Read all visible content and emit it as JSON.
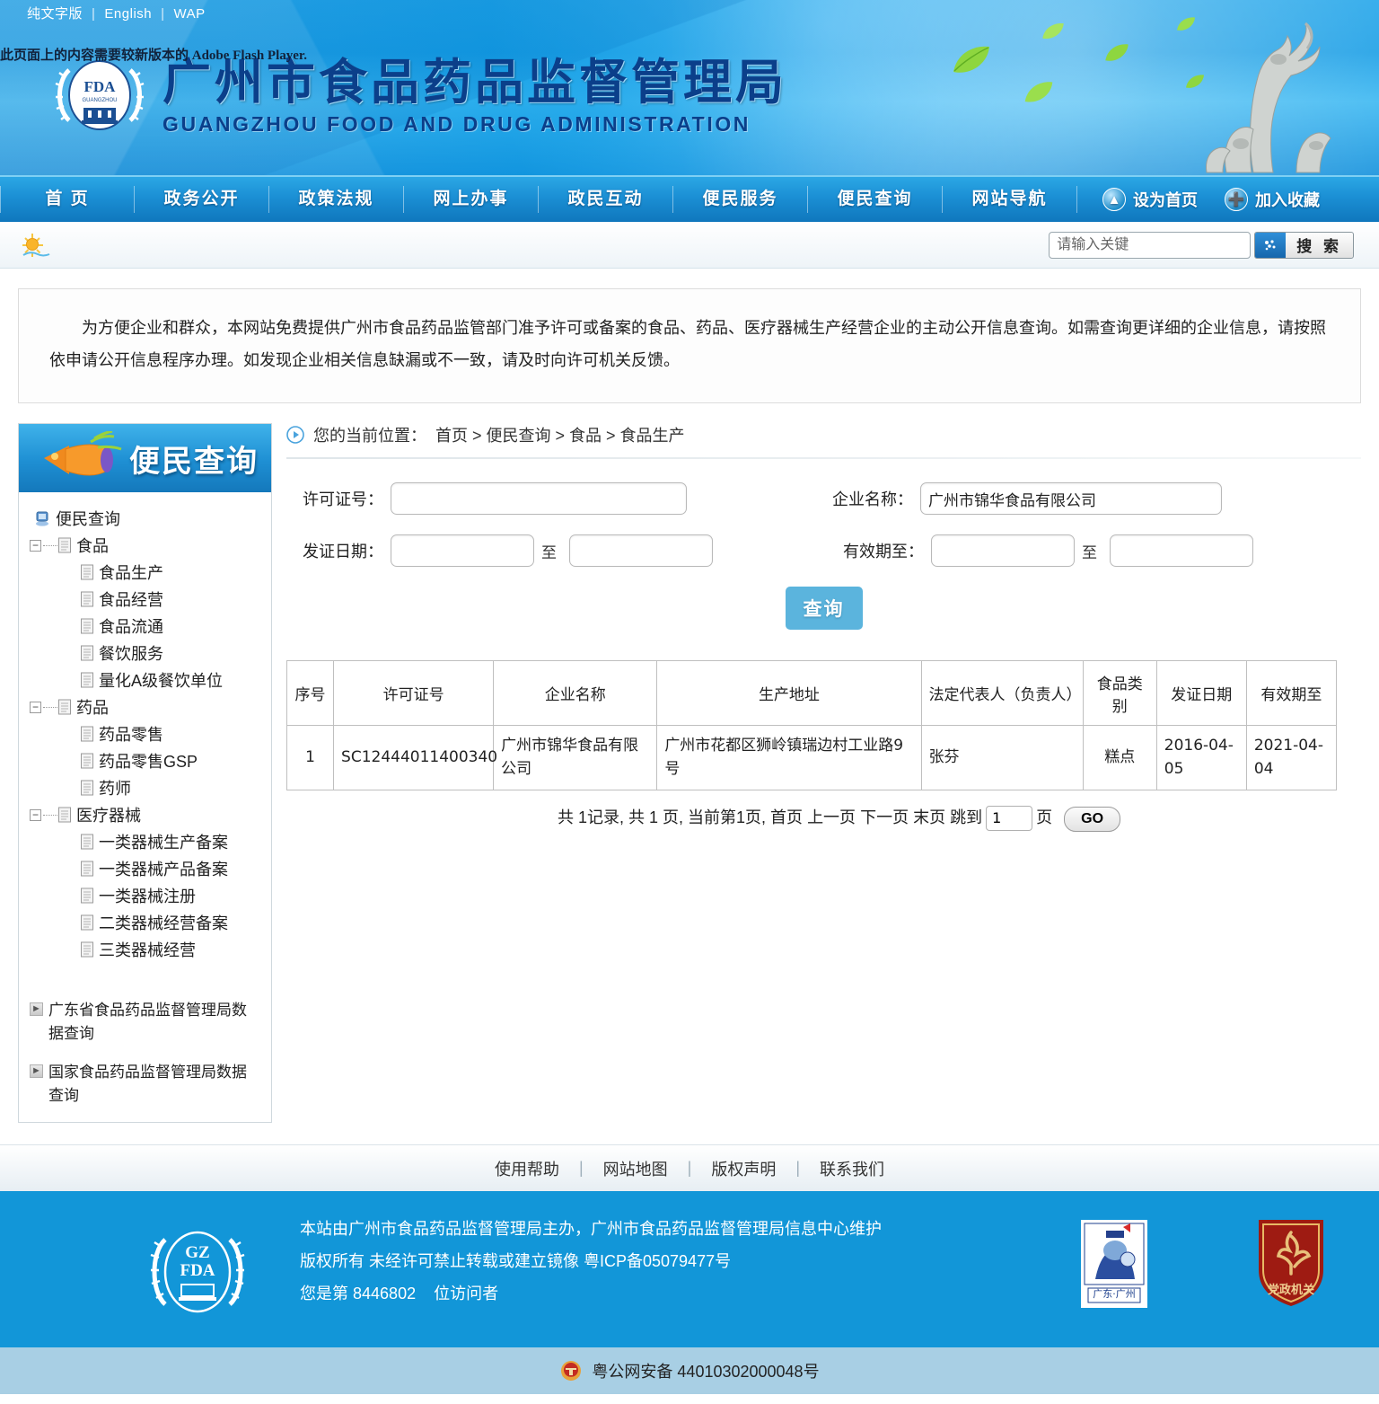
{
  "topbar": {
    "links": [
      "纯文字版",
      "English",
      "WAP"
    ],
    "flash_message": "此页面上的内容需要较新版本的 Adobe Flash Player."
  },
  "header": {
    "zh_title": "广州市食品药品监督管理局",
    "en_title": "GUANGZHOU FOOD AND DRUG ADMINISTRATION",
    "emblem_text": "FDA",
    "emblem_sub": "GZ"
  },
  "nav": {
    "items": [
      "首 页",
      "政务公开",
      "政策法规",
      "网上办事",
      "政民互动",
      "便民服务",
      "便民查询",
      "网站导航"
    ],
    "set_homepage": "设为首页",
    "add_favorite": "加入收藏"
  },
  "search": {
    "placeholder": "请输入关键",
    "button_label": "搜 索"
  },
  "notice": {
    "text": "为方便企业和群众，本网站免费提供广州市食品药品监管部门准予许可或备案的食品、药品、医疗器械生产经营企业的主动公开信息查询。如需查询更详细的企业信息，请按照依申请公开信息程序办理。如发现企业相关信息缺漏或不一致，请及时向许可机关反馈。"
  },
  "sidebar": {
    "panel_title": "便民查询",
    "tree": {
      "root": "便民查询",
      "groups": [
        {
          "label": "食品",
          "children": [
            "食品生产",
            "食品经营",
            "食品流通",
            "餐饮服务",
            "量化A级餐饮单位"
          ]
        },
        {
          "label": "药品",
          "children": [
            "药品零售",
            "药品零售GSP",
            "药师"
          ]
        },
        {
          "label": "医疗器械",
          "children": [
            "一类器械生产备案",
            "一类器械产品备案",
            "一类器械注册",
            "二类器械经营备案",
            "三类器械经营"
          ]
        }
      ]
    },
    "external_links": [
      "广东省食品药品监督管理局数据查询",
      "国家食品药品监督管理局数据查询"
    ]
  },
  "breadcrumb": {
    "prefix": "您的当前位置：",
    "path": "首页 > 便民查询 > 食品 > 食品生产"
  },
  "form": {
    "license_label": "许可证号：",
    "license_value": "",
    "enterprise_label": "企业名称：",
    "enterprise_value": "广州市锦华食品有限公司",
    "issue_date_label": "发证日期：",
    "issue_date_from": "",
    "issue_date_to": "",
    "valid_until_label": "有效期至：",
    "valid_until_from": "",
    "valid_until_to": "",
    "to_label": "至",
    "query_button": "查询"
  },
  "table": {
    "headers": [
      "序号",
      "许可证号",
      "企业名称",
      "生产地址",
      "法定代表人（负责人）",
      "食品类别",
      "发证日期",
      "有效期至"
    ],
    "rows": [
      {
        "no": "1",
        "license": "SC12444011400340",
        "enterprise": "广州市锦华食品有限公司",
        "address": "广州市花都区狮岭镇瑞边村工业路9号",
        "representative": "张芬",
        "category": "糕点",
        "issue_date": "2016-04-05",
        "valid_until": "2021-04-04"
      }
    ]
  },
  "pagination": {
    "total_text": "共 1记录, 共 1 页, 当前第1页,",
    "first": "首页",
    "prev": "上一页",
    "next": "下一页",
    "last": "末页",
    "jump_label": "跳到",
    "page_value": "1",
    "page_unit": "页",
    "go_label": "GO"
  },
  "footer": {
    "links": [
      "使用帮助",
      "网站地图",
      "版权声明",
      "联系我们"
    ],
    "line1": "本站由广州市食品药品监督管理局主办，广州市食品药品监督管理局信息中心维护",
    "line2": "版权所有 未经许可禁止转载或建立镜像 粤ICP备05079477号",
    "visitor_prefix": "您是第",
    "visitor_count": "8446802",
    "visitor_suffix": "位访问者",
    "police_badge_text": "广东 · 广州",
    "party_badge_text": "党政机关",
    "icp_text": "粤公网安备 44010302000048号",
    "seal_text": "GZ FDA"
  },
  "colors": {
    "brand_blue": "#1296d8",
    "nav_blue": "#1b8fd4",
    "title_blue": "#0b3f8a",
    "query_btn": "#5bb4dd",
    "icp_bar": "#a8cfe4"
  }
}
